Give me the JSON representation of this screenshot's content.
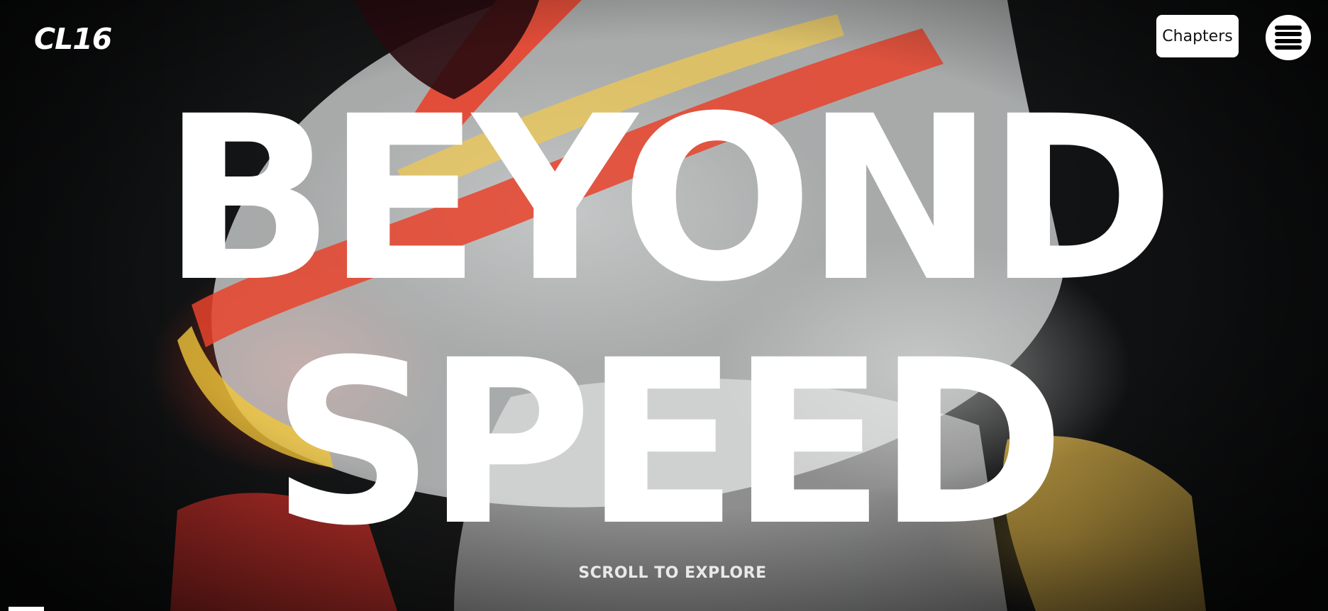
{
  "header": {
    "logo_text": "CL16",
    "chapters_label": "Chapters",
    "menu_icon": "hamburger-menu-icon"
  },
  "hero": {
    "headline_line1": "BEYOND",
    "headline_line2": "SPEED",
    "scroll_hint": "SCROLL TO EXPLORE",
    "background_description_icon": "helmet-video-background"
  },
  "colors": {
    "text": "#ffffff",
    "background": "#0d0e0f",
    "button_bg": "#ffffff",
    "button_text": "#111111"
  }
}
